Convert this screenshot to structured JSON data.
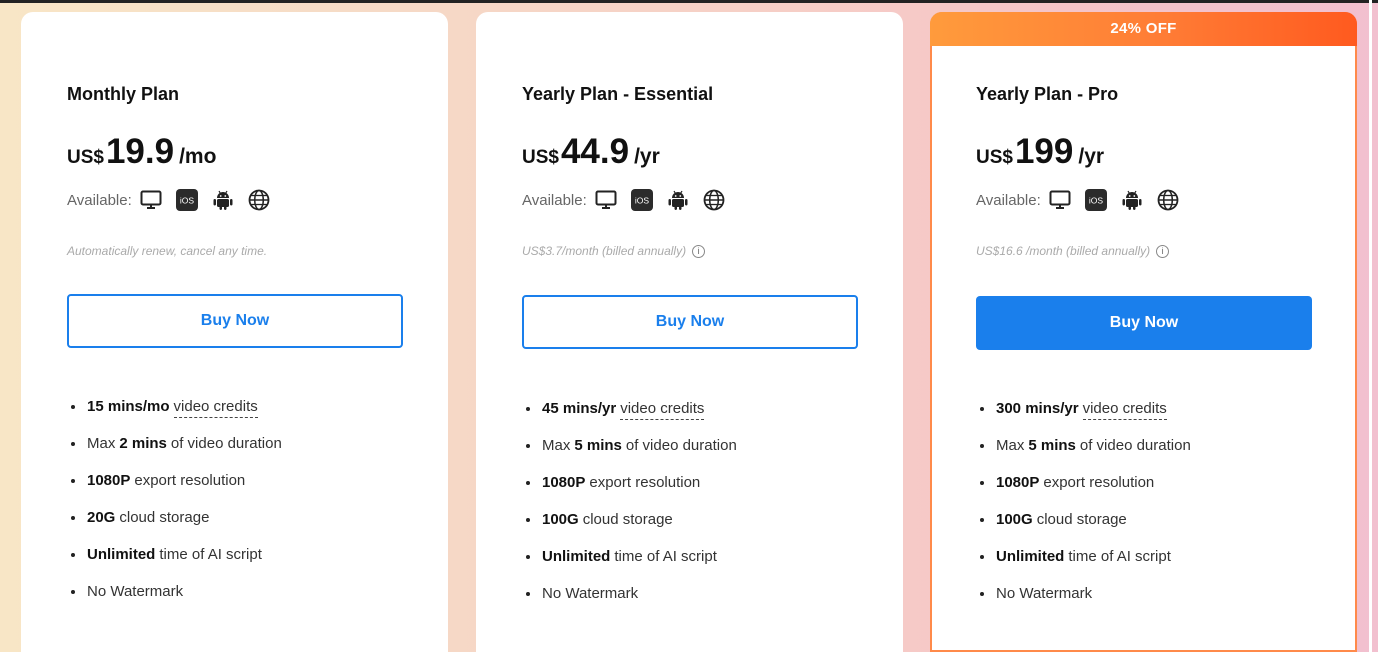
{
  "available_label": "Available:",
  "platform_icons": [
    "desktop-icon",
    "ios-icon",
    "android-icon",
    "web-icon"
  ],
  "ios_text": "iOS",
  "info_glyph": "i",
  "colors": {
    "accent_blue": "#1a7fec",
    "ribbon_start": "#ff9b3c",
    "ribbon_end": "#ff5a1f"
  },
  "plans": [
    {
      "name": "Monthly Plan",
      "currency": "US$",
      "amount": "19.9",
      "period": "/mo",
      "note": "Automatically renew, cancel any time.",
      "button": "Buy Now",
      "features": [
        {
          "bold": "15 mins/mo",
          "text": "video credits"
        },
        {
          "pre": "Max",
          "bold": "2 mins",
          "text": "of video duration"
        },
        {
          "bold": "1080P",
          "text": "export resolution"
        },
        {
          "bold": "20G",
          "text": "cloud storage"
        },
        {
          "bold": "Unlimited",
          "text": "time of AI script"
        },
        {
          "text": "No Watermark"
        }
      ]
    },
    {
      "name": "Yearly Plan - Essential",
      "currency": "US$",
      "amount": "44.9",
      "period": "/yr",
      "note": "US$3.7/month (billed annually)",
      "button": "Buy Now",
      "features": [
        {
          "bold": "45 mins/yr",
          "text": "video credits"
        },
        {
          "pre": "Max",
          "bold": "5 mins",
          "text": "of video duration"
        },
        {
          "bold": "1080P",
          "text": "export resolution"
        },
        {
          "bold": "100G",
          "text": "cloud storage"
        },
        {
          "bold": "Unlimited",
          "text": "time of AI script"
        },
        {
          "text": "No Watermark"
        }
      ]
    },
    {
      "badge": "24% OFF",
      "name": "Yearly Plan - Pro",
      "currency": "US$",
      "amount": "199",
      "period": "/yr",
      "note": "US$16.6 /month (billed annually)",
      "button": "Buy Now",
      "features": [
        {
          "bold": "300 mins/yr",
          "text": "video credits"
        },
        {
          "pre": "Max",
          "bold": "5 mins",
          "text": "of video duration"
        },
        {
          "bold": "1080P",
          "text": "export resolution"
        },
        {
          "bold": "100G",
          "text": "cloud storage"
        },
        {
          "bold": "Unlimited",
          "text": "time of AI script"
        },
        {
          "text": "No Watermark"
        }
      ]
    }
  ]
}
